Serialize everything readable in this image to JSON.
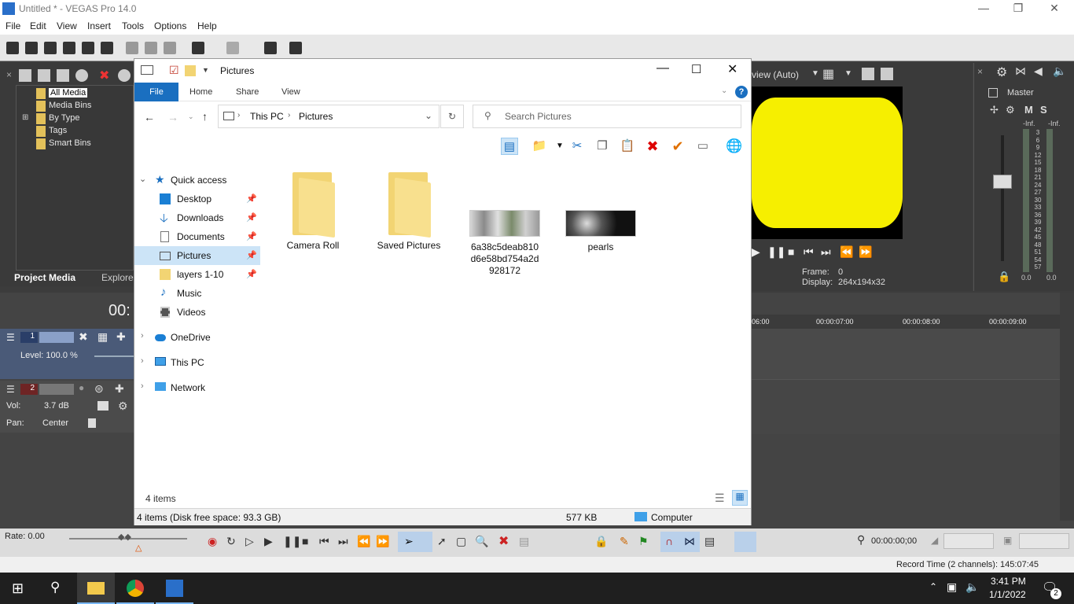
{
  "vegas": {
    "title": "Untitled * - VEGAS Pro 14.0",
    "menu": [
      "File",
      "Edit",
      "View",
      "Insert",
      "Tools",
      "Options",
      "Help"
    ],
    "project_media": {
      "items": [
        "All Media",
        "Media Bins",
        "By Type",
        "Tags",
        "Smart Bins"
      ],
      "tabs": [
        "Project Media",
        "Explorer"
      ]
    },
    "preview": {
      "quality": "view (Auto)",
      "frame_label": "Frame:",
      "frame_value": "0",
      "display_label": "Display:",
      "display_value": "264x194x32"
    },
    "mixer": {
      "title": "Master",
      "m": "M",
      "s": "S",
      "inf_left": "-Inf.",
      "inf_right": "-Inf.",
      "scale": [
        "3",
        "6",
        "9",
        "12",
        "15",
        "18",
        "21",
        "24",
        "27",
        "30",
        "33",
        "36",
        "39",
        "42",
        "45",
        "48",
        "51",
        "54",
        "57"
      ],
      "out_left": "0.0",
      "out_right": "0.0"
    },
    "timeline": {
      "time_partial": "00:",
      "ruler": [
        "06:00",
        "00:00:07:00",
        "00:00:08:00",
        "00:00:09:00"
      ],
      "track1": {
        "number": "1",
        "level": "Level: 100.0 %"
      },
      "track2": {
        "number": "2",
        "vol_label": "Vol:",
        "vol_value": "3.7 dB",
        "pan_label": "Pan:",
        "pan_value": "Center"
      }
    },
    "rate": "Rate: 0.00",
    "timecode": "00:00:00;00",
    "record_time": "Record Time (2 channels): 145:07:45"
  },
  "explorer": {
    "title": "Pictures",
    "ribbon_tabs": [
      "File",
      "Home",
      "Share",
      "View"
    ],
    "address": [
      "This PC",
      "Pictures"
    ],
    "search_placeholder": "Search Pictures",
    "nav": {
      "quick_access": "Quick access",
      "pinned": [
        "Desktop",
        "Downloads",
        "Documents",
        "Pictures",
        "layers 1-10"
      ],
      "others": [
        "Music",
        "Videos"
      ],
      "onedrive": "OneDrive",
      "this_pc": "This PC",
      "network": "Network"
    },
    "items": [
      {
        "name": "Camera Roll",
        "kind": "folder"
      },
      {
        "name": "Saved Pictures",
        "kind": "folder"
      },
      {
        "name": "6a38c5deab810d6e58bd754a2d928172",
        "kind": "image"
      },
      {
        "name": "pearls",
        "kind": "image"
      }
    ],
    "item_count": "4 items",
    "status_left": "4 items (Disk free space: 93.3 GB)",
    "status_size": "577 KB",
    "status_location": "Computer"
  },
  "taskbar": {
    "time": "3:41 PM",
    "date": "1/1/2022",
    "notification_count": "2"
  },
  "colors": {
    "accent": "#1a6fc0",
    "selection": "#cce4f7",
    "preview_yellow": "#f6ef00"
  }
}
